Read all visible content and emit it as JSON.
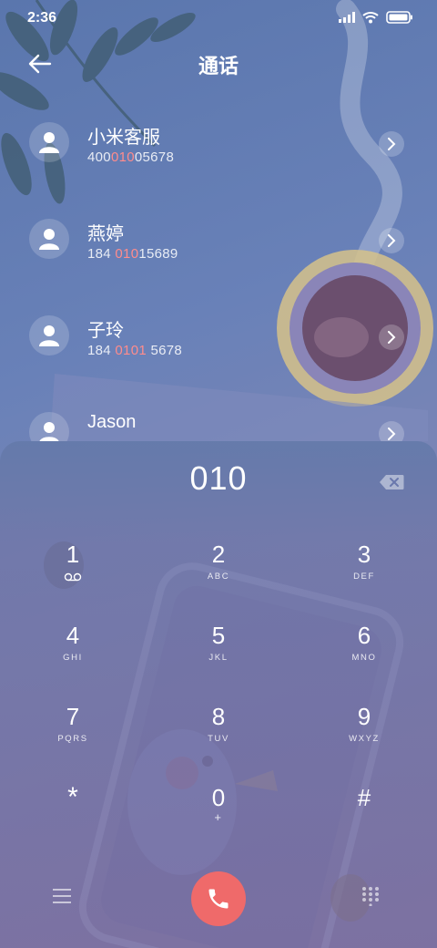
{
  "status_bar": {
    "time": "2:36"
  },
  "header": {
    "title": "通话"
  },
  "contacts": [
    {
      "name": "小米客服",
      "number_pre": "400",
      "number_match": "010",
      "number_post": "05678"
    },
    {
      "name": "燕婷",
      "number_pre": "184 ",
      "number_match": "010",
      "number_post": "15689"
    },
    {
      "name": "子玲",
      "number_pre": "184 ",
      "number_match": "0101",
      "number_post": " 5678"
    },
    {
      "name": "Jason",
      "number_pre": "",
      "number_match": "",
      "number_post": ""
    }
  ],
  "dialer": {
    "input": "010",
    "keys": [
      {
        "digit": "1",
        "letters": ""
      },
      {
        "digit": "2",
        "letters": "ABC"
      },
      {
        "digit": "3",
        "letters": "DEF"
      },
      {
        "digit": "4",
        "letters": "GHI"
      },
      {
        "digit": "5",
        "letters": "JKL"
      },
      {
        "digit": "6",
        "letters": "MNO"
      },
      {
        "digit": "7",
        "letters": "PQRS"
      },
      {
        "digit": "8",
        "letters": "TUV"
      },
      {
        "digit": "9",
        "letters": "WXYZ"
      },
      {
        "digit": "*",
        "letters": ""
      },
      {
        "digit": "0",
        "letters": "+"
      },
      {
        "digit": "#",
        "letters": ""
      }
    ]
  },
  "colors": {
    "accent_match": "#ff8c8c",
    "call_button": "#ef6a6a"
  },
  "icons": {
    "back": "arrow-left-icon",
    "contact": "person-icon",
    "chevron": "chevron-right-icon",
    "delete": "backspace-icon",
    "voicemail": "voicemail-icon",
    "menu": "menu-icon",
    "call": "phone-icon",
    "keypad": "keypad-grid-icon"
  }
}
